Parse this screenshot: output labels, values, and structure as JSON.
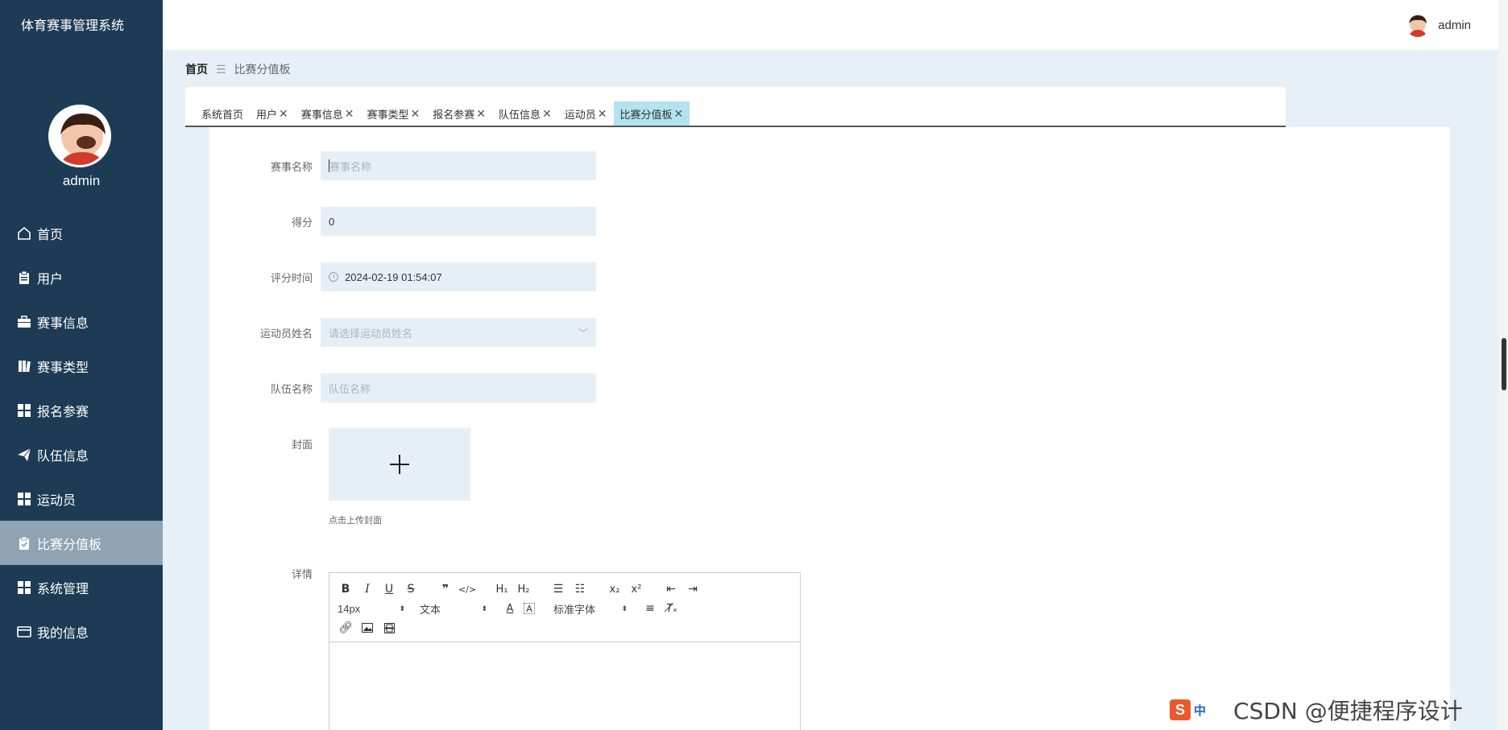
{
  "app": {
    "title": "体育赛事管理系统"
  },
  "sidebar": {
    "username": "admin",
    "items": [
      {
        "label": "首页",
        "icon": "home-icon"
      },
      {
        "label": "用户",
        "icon": "clipboard-icon"
      },
      {
        "label": "赛事信息",
        "icon": "briefcase-icon"
      },
      {
        "label": "赛事类型",
        "icon": "book-icon"
      },
      {
        "label": "报名参赛",
        "icon": "grid-icon"
      },
      {
        "label": "队伍信息",
        "icon": "paper-plane-icon"
      },
      {
        "label": "运动员",
        "icon": "grid-icon"
      },
      {
        "label": "比赛分值板",
        "icon": "clipboard-check-icon",
        "active": true
      },
      {
        "label": "系统管理",
        "icon": "grid-icon"
      },
      {
        "label": "我的信息",
        "icon": "card-icon"
      }
    ]
  },
  "header": {
    "username": "admin"
  },
  "breadcrumb": {
    "home": "首页",
    "separator": "☰",
    "current": "比赛分值板"
  },
  "tabs": [
    {
      "label": "系统首页",
      "closable": false
    },
    {
      "label": "用户",
      "closable": true
    },
    {
      "label": "赛事信息",
      "closable": true
    },
    {
      "label": "赛事类型",
      "closable": true
    },
    {
      "label": "报名参赛",
      "closable": true
    },
    {
      "label": "队伍信息",
      "closable": true
    },
    {
      "label": "运动员",
      "closable": true
    },
    {
      "label": "比赛分值板",
      "closable": true,
      "active": true
    }
  ],
  "form": {
    "event_name": {
      "label": "赛事名称",
      "value": "",
      "placeholder": "赛事名称"
    },
    "score": {
      "label": "得分",
      "value": "0"
    },
    "score_time": {
      "label": "评分时间",
      "value": "2024-02-19 01:54:07"
    },
    "athlete": {
      "label": "运动员姓名",
      "placeholder": "请选择运动员姓名"
    },
    "team": {
      "label": "队伍名称",
      "placeholder": "队伍名称"
    },
    "cover": {
      "label": "封面",
      "hint": "点击上传封面"
    },
    "details": {
      "label": "详情"
    }
  },
  "editor": {
    "font_size": "14px",
    "text_style": "文本",
    "font_family": "标准字体"
  },
  "watermark": {
    "ime_char": "中",
    "text": "CSDN @便捷程序设计"
  },
  "colors": {
    "sidebar": "#1d3b54",
    "active_tab": "#b3e3ee",
    "active_menu": "#8fa3b2",
    "input_bg": "#e7eff6"
  }
}
